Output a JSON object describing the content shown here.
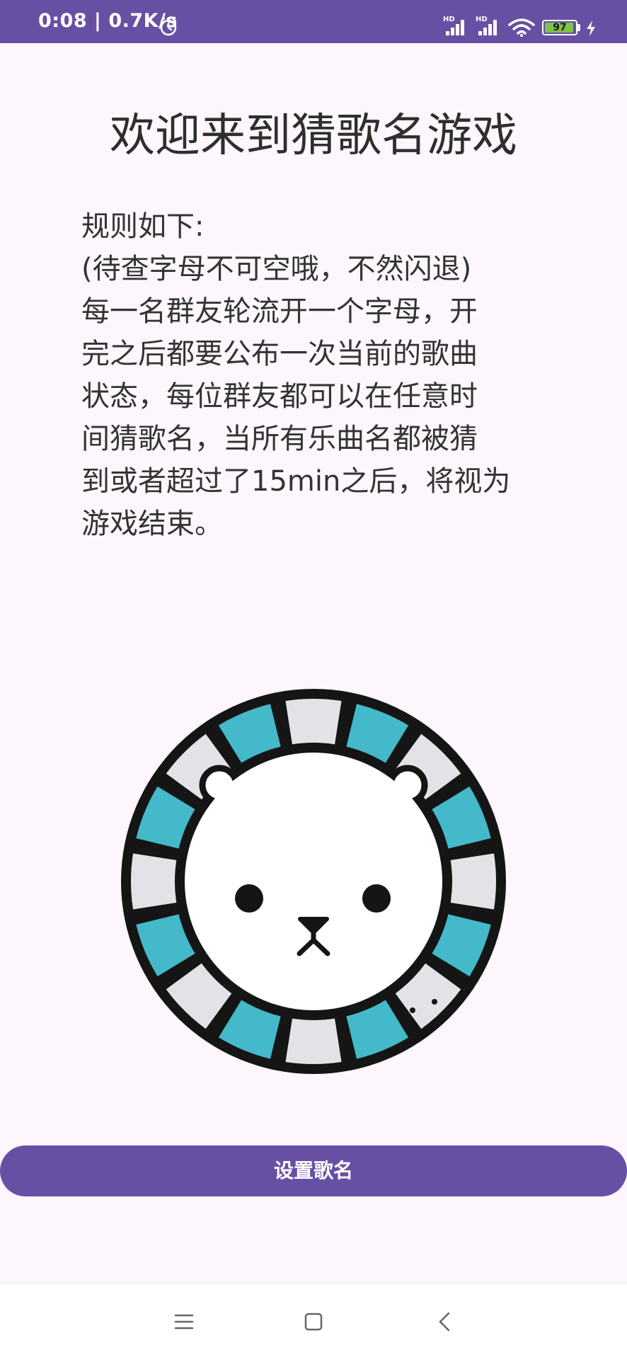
{
  "status_bar": {
    "time": "0:08 | 0.7K/s",
    "battery_level": "97",
    "network_label_1": "HD",
    "network_label_2": "HD",
    "icons": [
      "alarm-icon",
      "signal-icon",
      "signal-icon",
      "wifi-icon",
      "battery-icon",
      "charging-icon"
    ]
  },
  "page": {
    "title": "欢迎来到猜歌名游戏",
    "rules": "规则如下:\n(待查字母不可空哦，不然闪退)\n每一名群友轮流开一个字母，开\n完之后都要公布一次当前的歌曲\n状态，每位群友都可以在任意时\n间猜歌名，当所有乐曲名都被猜\n到或者超过了15min之后，将视为\n游戏结束。",
    "avatar_icon": "polar-bear-avatar-icon",
    "set_button_label": "设置歌名"
  },
  "nav_bar": {
    "icons": [
      "menu-icon",
      "home-icon",
      "back-icon"
    ]
  },
  "colors": {
    "primary": "#6750a4",
    "background": "#fdf7fd",
    "ring_teal": "#43b9c9",
    "ring_gray": "#e4e2e6"
  }
}
